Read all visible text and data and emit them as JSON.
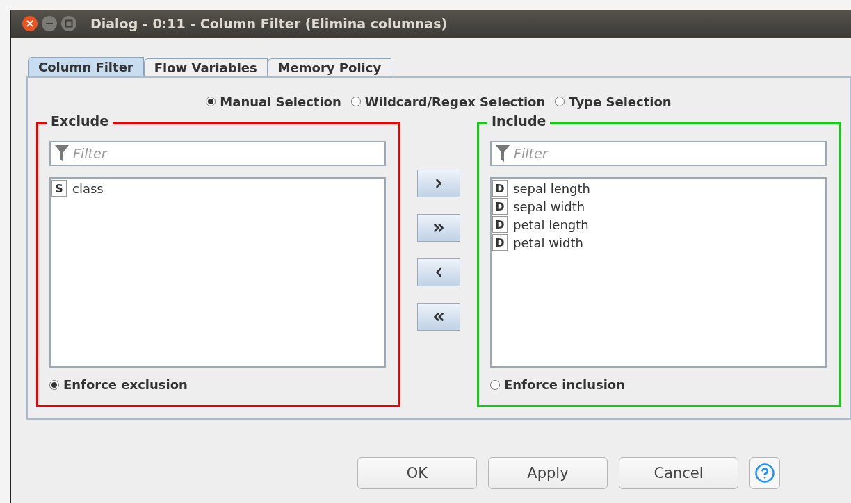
{
  "window": {
    "title": "Dialog - 0:11 - Column Filter (Elimina columnas)"
  },
  "tabs": [
    {
      "label": "Column Filter",
      "selected": true
    },
    {
      "label": "Flow Variables",
      "selected": false
    },
    {
      "label": "Memory Policy",
      "selected": false
    }
  ],
  "selection_modes": [
    {
      "label": "Manual Selection",
      "selected": true
    },
    {
      "label": "Wildcard/Regex Selection",
      "selected": false
    },
    {
      "label": "Type Selection",
      "selected": false
    }
  ],
  "exclude": {
    "title": "Exclude",
    "color": "#ee0000",
    "filter": {
      "placeholder": "Filter"
    },
    "items": [
      {
        "type": "S",
        "name": "class"
      }
    ],
    "enforce": {
      "label": "Enforce exclusion",
      "selected": true
    }
  },
  "include": {
    "title": "Include",
    "color": "#11cc11",
    "filter": {
      "placeholder": "Filter"
    },
    "items": [
      {
        "type": "D",
        "name": "sepal length"
      },
      {
        "type": "D",
        "name": "sepal width"
      },
      {
        "type": "D",
        "name": "petal length"
      },
      {
        "type": "D",
        "name": "petal width"
      }
    ],
    "enforce": {
      "label": "Enforce inclusion",
      "selected": false
    }
  },
  "buttons": [
    {
      "label": "OK"
    },
    {
      "label": "Apply"
    },
    {
      "label": "Cancel"
    }
  ]
}
